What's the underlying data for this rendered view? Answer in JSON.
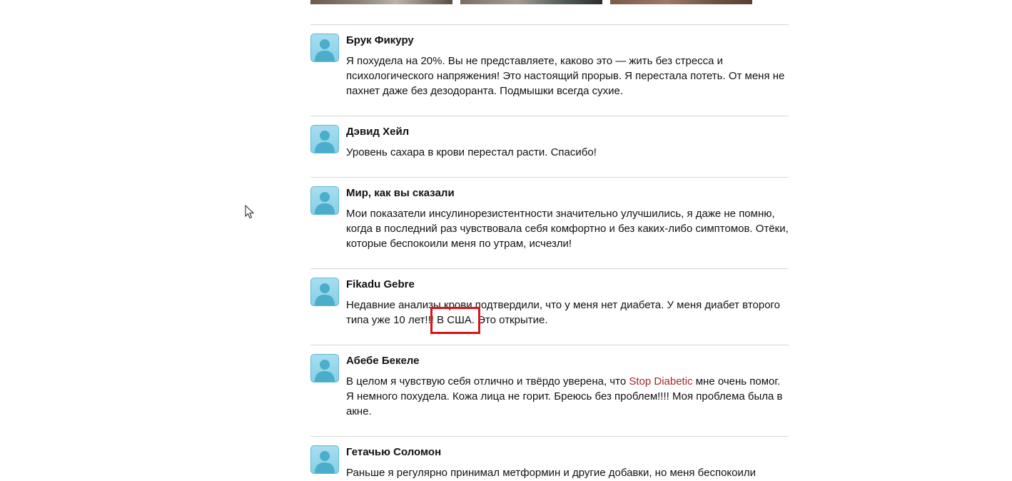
{
  "comments": [
    {
      "name": "Брук Фикуру",
      "lines": [
        "Я похудела на 20%. Вы не представляете, каково это — жить без стресса и",
        "психологического напряжения! Это настоящий прорыв. Я перестала потеть. От меня не",
        "пахнет даже без дезодоранта. Подмышки всегда сухие."
      ]
    },
    {
      "name": "Дэвид Хейл",
      "lines": [
        "Уровень сахара в крови перестал расти. Спасибо!"
      ]
    },
    {
      "name": "Мир, как вы сказали",
      "lines": [
        "Мои показатели инсулинорезистентности значительно улучшились, я даже не помню,",
        "когда в последний раз чувствовала себя комфортно и без каких-либо симптомов. Отёки,",
        "которые беспокоили меня по утрам, исчезли!"
      ]
    },
    {
      "name": "Fikadu Gebre",
      "lines": [
        "Недавние анализы крови подтвердили, что у меня нет диабета. У меня диабет второго"
      ],
      "line2_before": "типа уже 10 лет!!",
      "line2_highlight": "! В США.",
      "line2_after": " Это открытие."
    },
    {
      "name": "Абебе Бекеле",
      "line1_before": "В целом я чувствую себя отлично и твёрдо уверена, что ",
      "line1_brand": "Stop Diabetic",
      "line1_after": " мне очень помог.",
      "lines": [
        "Я немного похудела. Кожа лица не горит. Бреюсь без проблем!!!! Моя проблема была в",
        "акне."
      ]
    },
    {
      "name": "Гетачью Соломон",
      "lines": [
        "Раньше я регулярно принимал метформин и другие добавки, но меня беспокоили"
      ]
    }
  ],
  "colors": {
    "brand_link": "#a0272d",
    "highlight_border": "#d9151b",
    "divider": "#d6d6d6",
    "avatar_bg": "#8fd3ea",
    "avatar_silhouette": "#4aaecb"
  },
  "icons": {
    "avatar": "user-silhouette-icon",
    "cursor": "mouse-pointer-icon"
  }
}
